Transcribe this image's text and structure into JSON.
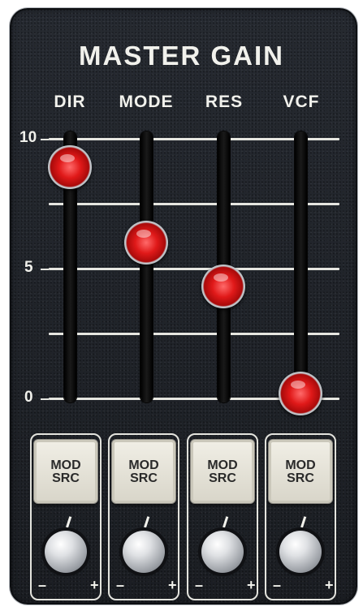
{
  "title": "MASTER GAIN",
  "columns": [
    {
      "label": "DIR",
      "level": 8.9
    },
    {
      "label": "MODE",
      "level": 6.0
    },
    {
      "label": "RES",
      "level": 4.3
    },
    {
      "label": "VCF",
      "level": 0.2
    }
  ],
  "scale": {
    "max": "10",
    "mid": "5",
    "min": "0"
  },
  "modules": [
    {
      "button_line1": "MOD",
      "button_line2": "SRC",
      "minus": "–",
      "plus": "+"
    },
    {
      "button_line1": "MOD",
      "button_line2": "SRC",
      "minus": "–",
      "plus": "+"
    },
    {
      "button_line1": "MOD",
      "button_line2": "SRC",
      "minus": "–",
      "plus": "+"
    },
    {
      "button_line1": "MOD",
      "button_line2": "SRC",
      "minus": "–",
      "plus": "+"
    }
  ],
  "colors": {
    "fader": "#e01919",
    "panel": "#1f2227",
    "text": "#f1f1ec"
  }
}
